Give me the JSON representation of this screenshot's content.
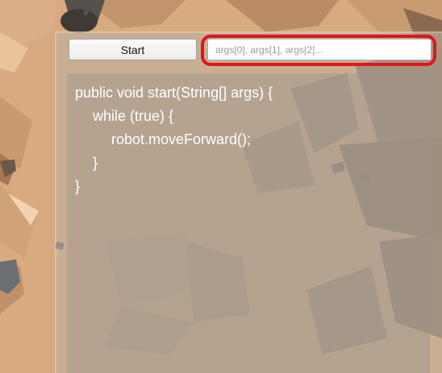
{
  "toolbar": {
    "start_label": "Start"
  },
  "args_input": {
    "value": "",
    "placeholder": "args[0], args[1], args[2]..."
  },
  "code_editor": {
    "lines": [
      {
        "text": "public void start(String[] args) {",
        "indent": 0
      },
      {
        "text": "while (true) {",
        "indent": 1
      },
      {
        "text": "robot.moveForward();",
        "indent": 2
      },
      {
        "text": "}",
        "indent": 1
      },
      {
        "text": "}",
        "indent": 0
      }
    ]
  },
  "colors": {
    "highlight": "#e0151f",
    "ground": "#d7a97f",
    "code_text": "#ffffff"
  }
}
